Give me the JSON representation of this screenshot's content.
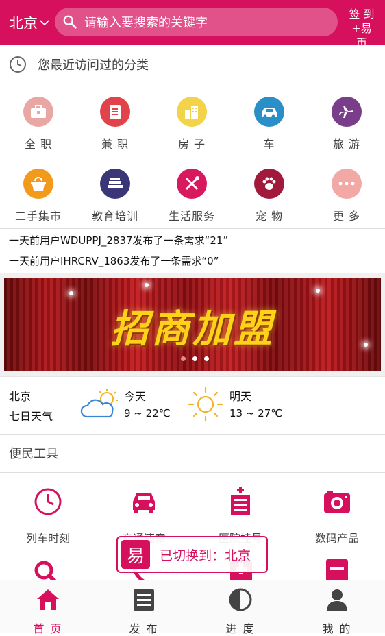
{
  "header": {
    "city": "北京",
    "search_placeholder": "请输入要搜索的关键字",
    "signin_line1": "签 到",
    "signin_line2": "+易币"
  },
  "recent": {
    "label": "您最近访问过的分类"
  },
  "categories": [
    {
      "label": "全 职",
      "icon": "briefcase-icon",
      "color": "#e9a7a4"
    },
    {
      "label": "兼 职",
      "icon": "document-list-icon",
      "color": "#e2434b"
    },
    {
      "label": "房 子",
      "icon": "buildings-icon",
      "color": "#f3d34a"
    },
    {
      "label": "车",
      "icon": "car-icon",
      "color": "#2a8ec8"
    },
    {
      "label": "旅 游",
      "icon": "airplane-icon",
      "color": "#7a3d8a"
    },
    {
      "label": "二手集市",
      "icon": "basket-icon",
      "color": "#f19a1c"
    },
    {
      "label": "教育培训",
      "icon": "books-icon",
      "color": "#3b3677"
    },
    {
      "label": "生活服务",
      "icon": "tools-icon",
      "color": "#d8195e"
    },
    {
      "label": "宠 物",
      "icon": "paw-icon",
      "color": "#a11a3b"
    },
    {
      "label": "更 多",
      "icon": "more-icon",
      "color": "#f2a8a4"
    }
  ],
  "notices": [
    "一天前用户WDUPPJ_2837发布了一条需求“21”",
    "一天前用户IHRCRV_1863发布了一条需求“0”"
  ],
  "banner": {
    "title": "招商加盟",
    "slides": 3,
    "active_slide": 2
  },
  "weather": {
    "city": "北京",
    "subtitle": "七日天气",
    "today": {
      "label": "今天",
      "temp": "9 ~ 22℃",
      "icon": "partly-cloudy-icon"
    },
    "tomorrow": {
      "label": "明天",
      "temp": "13 ~ 27℃",
      "icon": "sunny-icon"
    }
  },
  "tools": {
    "title": "便民工具",
    "items": [
      {
        "label": "列车时刻",
        "icon": "clock-icon"
      },
      {
        "label": "交通违章",
        "icon": "car-front-icon"
      },
      {
        "label": "医院挂号",
        "icon": "hospital-icon"
      },
      {
        "label": "数码产品",
        "icon": "camera-icon"
      }
    ]
  },
  "toast": {
    "badge": "易",
    "text": "已切换到：北京"
  },
  "nav": [
    {
      "label": "首 页",
      "icon": "home-icon",
      "active": true
    },
    {
      "label": "发 布",
      "icon": "publish-list-icon",
      "active": false
    },
    {
      "label": "进 度",
      "icon": "progress-pie-icon",
      "active": false
    },
    {
      "label": "我 的",
      "icon": "user-icon",
      "active": false
    }
  ],
  "colors": {
    "brand": "#d6105d",
    "text": "#333333",
    "divider": "#dddddd"
  }
}
